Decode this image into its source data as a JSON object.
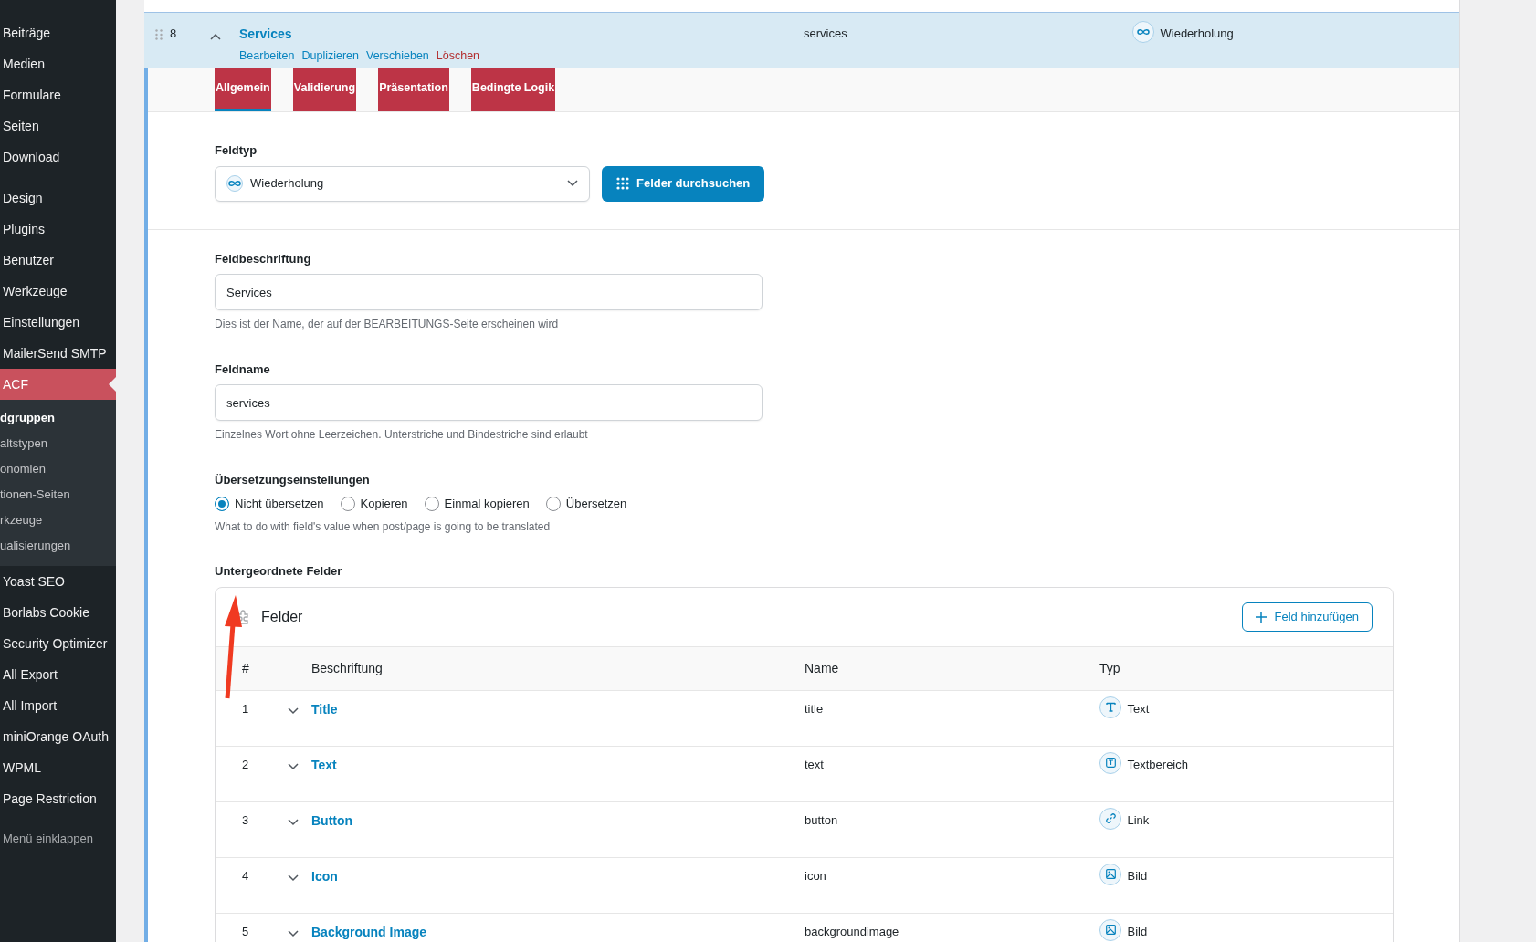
{
  "sidebar": {
    "groups": [
      {
        "items": [
          {
            "label": "Beiträge",
            "selected": false
          },
          {
            "label": "Medien",
            "selected": false
          },
          {
            "label": "Formulare",
            "selected": false
          },
          {
            "label": "Seiten",
            "selected": false
          },
          {
            "label": "Download",
            "selected": false
          }
        ]
      },
      {
        "items": [
          {
            "label": "Design",
            "selected": false
          },
          {
            "label": "Plugins",
            "selected": false
          },
          {
            "label": "Benutzer",
            "selected": false
          },
          {
            "label": "Werkzeuge",
            "selected": false
          },
          {
            "label": "Einstellungen",
            "selected": false
          },
          {
            "label": "MailerSend SMTP",
            "selected": false
          },
          {
            "label": "ACF",
            "selected": true,
            "children": [
              {
                "label": "dgruppen",
                "selected": true
              },
              {
                "label": "altstypen",
                "selected": false
              },
              {
                "label": "onomien",
                "selected": false
              },
              {
                "label": "tionen-Seiten",
                "selected": false
              },
              {
                "label": "rkzeuge",
                "selected": false
              },
              {
                "label": "ualisierungen",
                "selected": false
              }
            ]
          },
          {
            "label": "Yoast SEO",
            "selected": false
          },
          {
            "label": "Borlabs Cookie",
            "selected": false
          },
          {
            "label": "Security Optimizer",
            "selected": false
          },
          {
            "label": "All Export",
            "selected": false
          },
          {
            "label": "All Import",
            "selected": false
          },
          {
            "label": "miniOrange OAuth",
            "selected": false
          },
          {
            "label": "WPML",
            "selected": false
          },
          {
            "label": "Page Restriction",
            "selected": false
          }
        ]
      }
    ],
    "collapse": "Menü einklappen"
  },
  "field_row": {
    "order": "8",
    "expanded": true,
    "label": "Services",
    "actions": [
      {
        "label": "Bearbeiten",
        "kind": "link"
      },
      {
        "label": "Duplizieren",
        "kind": "link"
      },
      {
        "label": "Verschieben",
        "kind": "link"
      },
      {
        "label": "Löschen",
        "kind": "danger"
      }
    ],
    "name": "services",
    "type": {
      "label": "Wiederholung",
      "kind": "repeater"
    }
  },
  "tabs": [
    {
      "label": "Allgemein",
      "selected": true
    },
    {
      "label": "Validierung",
      "selected": false
    },
    {
      "label": "Präsentation",
      "selected": false
    },
    {
      "label": "Bedingte Logik",
      "selected": false
    }
  ],
  "field_type": {
    "label": "Feldtyp",
    "value": "Wiederholung",
    "kind": "repeater",
    "button": "Felder durchsuchen"
  },
  "inputs": [
    {
      "label": "Feldbeschriftung",
      "value": "Services",
      "hint": "Dies ist der Name, der auf der BEARBEITUNGS-Seite erscheinen wird"
    },
    {
      "label": "Feldname",
      "value": "services",
      "hint": "Einzelnes Wort ohne Leerzeichen. Unterstriche und Bindestriche sind erlaubt"
    }
  ],
  "translation": {
    "label": "Übersetzungseinstellungen",
    "options": [
      {
        "label": "Nicht übersetzen",
        "selected": true
      },
      {
        "label": "Kopieren",
        "selected": false
      },
      {
        "label": "Einmal kopieren",
        "selected": false
      },
      {
        "label": "Übersetzen",
        "selected": false
      }
    ],
    "hint": "What to do with field's value when post/page is going to be translated"
  },
  "sub_fields": {
    "label": "Untergeordnete Felder",
    "title": "Felder",
    "add_button": "Feld hinzufügen",
    "columns": [
      "#",
      "Beschriftung",
      "Name",
      "Typ"
    ],
    "rows": [
      {
        "order": "1",
        "expanded": false,
        "label": "Title",
        "name": "title",
        "type": "Text",
        "kind": "text"
      },
      {
        "order": "2",
        "expanded": false,
        "label": "Text",
        "name": "text",
        "type": "Textbereich",
        "kind": "textarea"
      },
      {
        "order": "3",
        "expanded": false,
        "label": "Button",
        "name": "button",
        "type": "Link",
        "kind": "link"
      },
      {
        "order": "4",
        "expanded": false,
        "label": "Icon",
        "name": "icon",
        "type": "Bild",
        "kind": "image"
      },
      {
        "order": "5",
        "expanded": false,
        "label": "Background Image",
        "name": "backgroundimage",
        "type": "Bild",
        "kind": "image"
      }
    ]
  }
}
